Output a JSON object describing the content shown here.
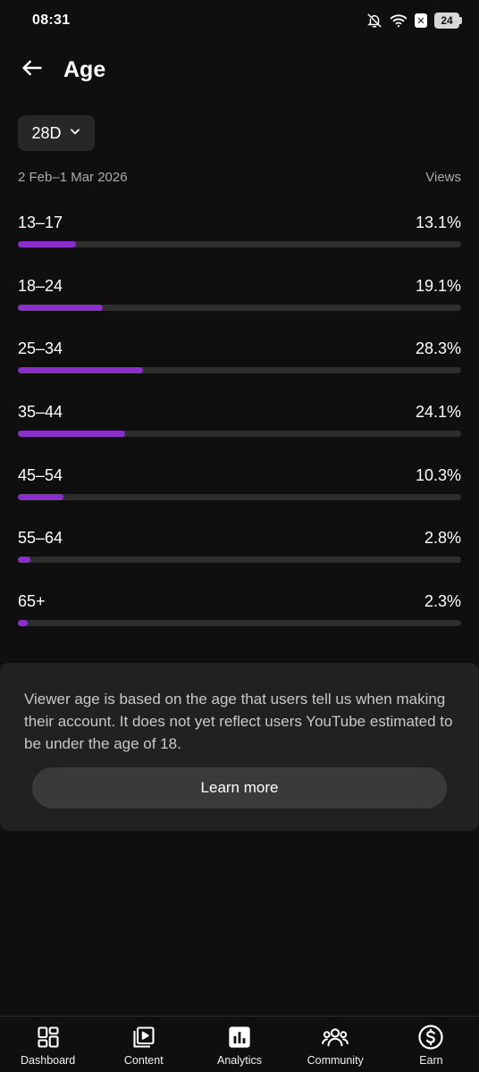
{
  "status_bar": {
    "time": "08:31",
    "battery": "24",
    "icons": [
      "bell-off-icon",
      "wifi-icon",
      "x-app-icon",
      "battery-icon"
    ]
  },
  "header": {
    "title": "Age",
    "back_icon": "arrow-left-icon"
  },
  "filter": {
    "period": "28D",
    "icon": "chevron-down-icon"
  },
  "summary": {
    "date_range": "2 Feb–1 Mar 2026",
    "metric": "Views"
  },
  "colors": {
    "bar": "#8b2fc9",
    "track": "#2e2e2e",
    "background": "#0f0f0f"
  },
  "age_groups": [
    {
      "label": "13–17",
      "value_text": "13.1%",
      "fill_fraction": 0.131
    },
    {
      "label": "18–24",
      "value_text": "19.1%",
      "fill_fraction": 0.191
    },
    {
      "label": "25–34",
      "value_text": "28.3%",
      "fill_fraction": 0.283
    },
    {
      "label": "35–44",
      "value_text": "24.1%",
      "fill_fraction": 0.241
    },
    {
      "label": "45–54",
      "value_text": "10.3%",
      "fill_fraction": 0.103
    },
    {
      "label": "55–64",
      "value_text": "2.8%",
      "fill_fraction": 0.028
    },
    {
      "label": "65+",
      "value_text": "2.3%",
      "fill_fraction": 0.023
    }
  ],
  "info": {
    "text": "Viewer age is based on the age that users tell us when making their account. It does not yet reflect users YouTube estimated to be under the age of 18.",
    "button_label": "Learn more"
  },
  "bottom_nav": {
    "items": [
      {
        "label": "Dashboard",
        "icon": "dashboard-icon"
      },
      {
        "label": "Content",
        "icon": "content-icon"
      },
      {
        "label": "Analytics",
        "icon": "analytics-icon"
      },
      {
        "label": "Community",
        "icon": "community-icon"
      },
      {
        "label": "Earn",
        "icon": "earn-icon"
      }
    ]
  }
}
